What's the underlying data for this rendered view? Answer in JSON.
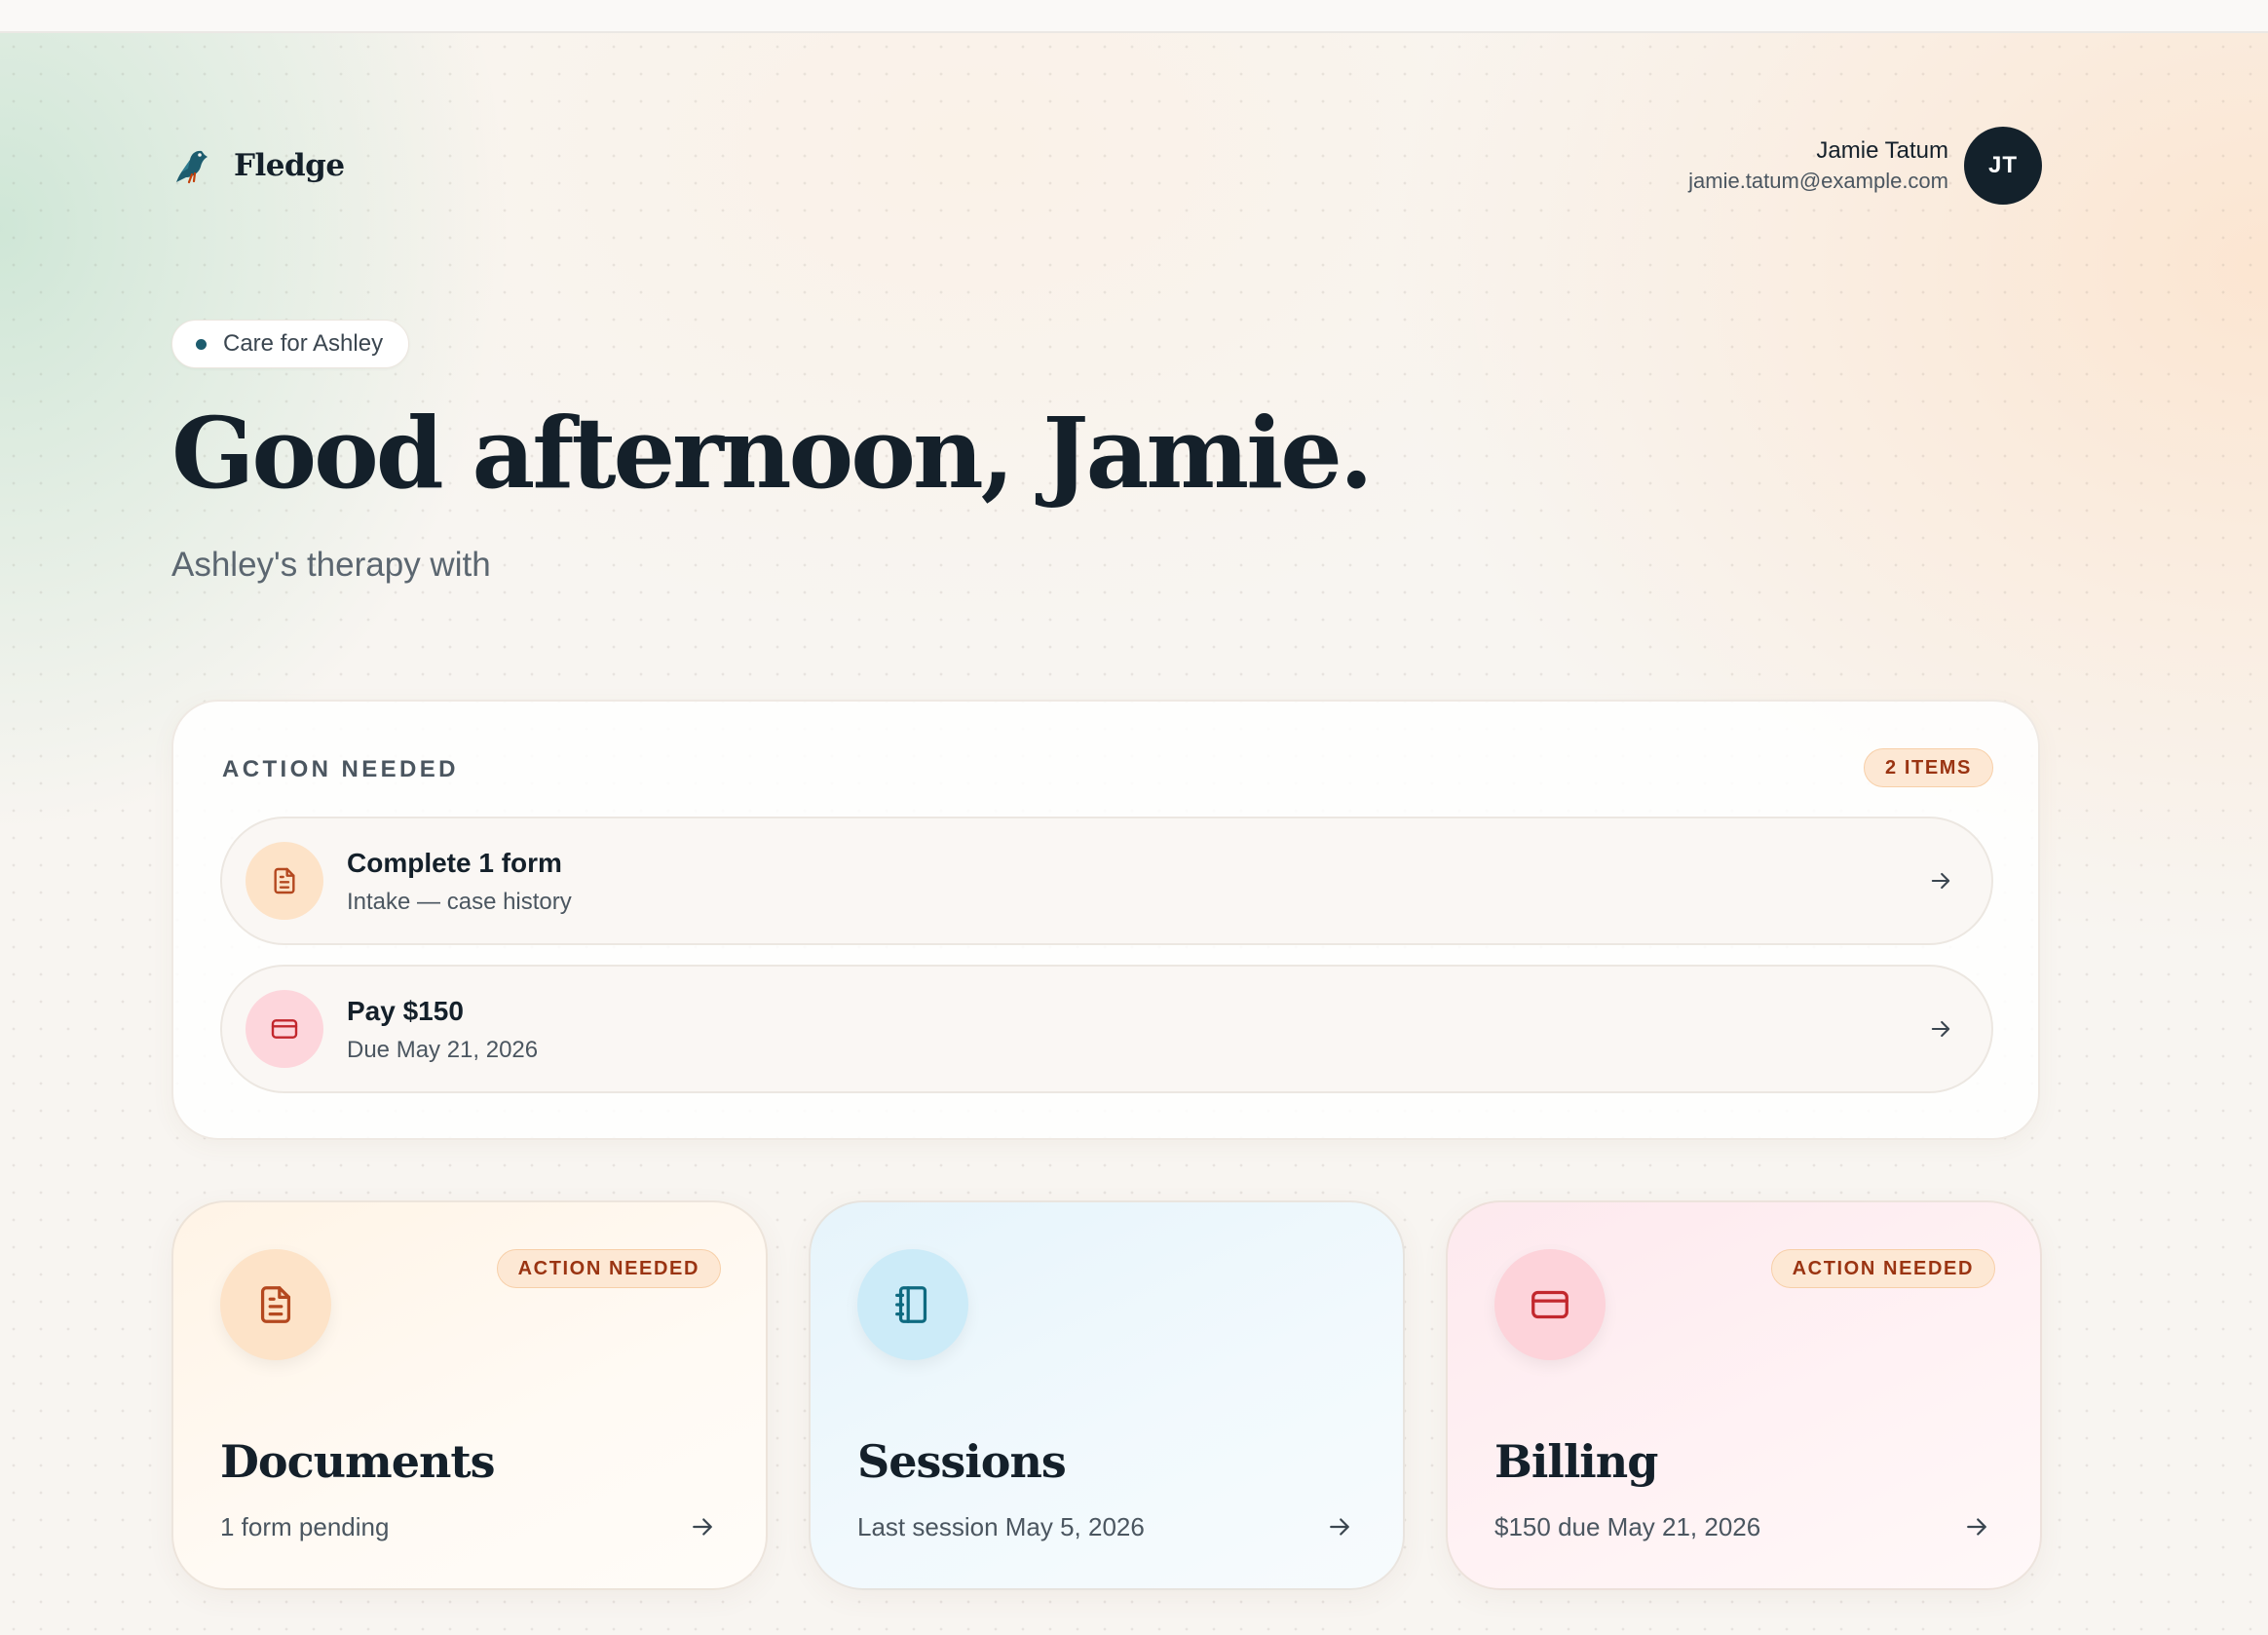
{
  "brand": {
    "name": "Fledge",
    "icon": "bird-icon"
  },
  "user": {
    "name": "Jamie Tatum",
    "email": "jamie.tatum@example.com",
    "initials": "JT"
  },
  "hero": {
    "pill": "Care for Ashley",
    "greeting": "Good afternoon, Jamie.",
    "subtitle": "Ashley's therapy with"
  },
  "action_needed": {
    "title": "ACTION NEEDED",
    "badge": "2 ITEMS",
    "items": [
      {
        "title": "Complete 1 form",
        "subtitle": "Intake — case history",
        "icon": "document-icon"
      },
      {
        "title": "Pay $150",
        "subtitle": "Due May 21, 2026",
        "icon": "credit-card-icon"
      }
    ]
  },
  "tiles": [
    {
      "title": "Documents",
      "subtitle": "1 form pending",
      "badge": "ACTION NEEDED",
      "icon": "document-icon"
    },
    {
      "title": "Sessions",
      "subtitle": "Last session May 5, 2026",
      "badge": "",
      "icon": "notebook-icon"
    },
    {
      "title": "Billing",
      "subtitle": "$150 due May 21, 2026",
      "badge": "ACTION NEEDED",
      "icon": "credit-card-icon"
    }
  ],
  "colors": {
    "ink": "#14202a",
    "accent_teal": "#1d5c6e",
    "badge_text": "#9a3412",
    "badge_bg": "#fde8d4",
    "doc_icon": "#b4481f",
    "card_icon": "#c2272d",
    "notebook_icon": "#0e6a80"
  }
}
